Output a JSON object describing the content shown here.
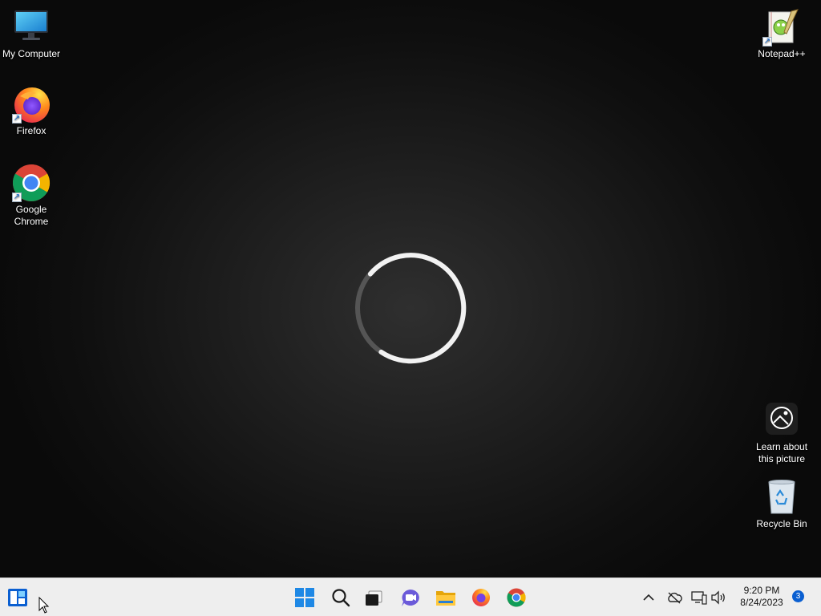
{
  "desktop": {
    "icons": {
      "my_computer": "My Computer",
      "firefox": "Firefox",
      "google_chrome": "Google\nChrome",
      "notepadpp": "Notepad++",
      "learn_picture": "Learn about\nthis picture",
      "recycle_bin": "Recycle Bin"
    },
    "icon_names": [
      "monitor-icon",
      "firefox-icon",
      "chrome-icon",
      "notepadpp-icon",
      "info-camera-icon",
      "recycle-bin-icon"
    ],
    "loading_spinner": true
  },
  "taskbar": {
    "widgets_icon": "widgets-icon",
    "pinned": [
      "start-icon",
      "search-icon",
      "task-view-icon",
      "chat-icon",
      "file-explorer-icon",
      "firefox-icon",
      "chrome-icon"
    ],
    "tray": [
      "chevron-up-icon",
      "onedrive-offline-icon",
      "network-icon",
      "volume-icon"
    ],
    "clock": {
      "time": "9:20 PM",
      "date": "8/24/2023"
    },
    "notification_count": "3"
  },
  "colors": {
    "windows_blue": "#0a5fd1",
    "taskbar_bg": "#eeeeee"
  }
}
